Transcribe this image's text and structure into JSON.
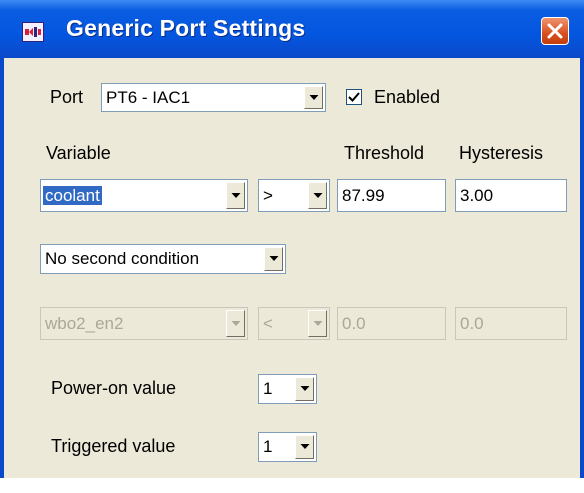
{
  "window": {
    "title": "Generic Port Settings"
  },
  "port": {
    "label": "Port",
    "value": "PT6 - IAC1"
  },
  "enabled": {
    "label": "Enabled",
    "checked": true
  },
  "headers": {
    "variable": "Variable",
    "threshold": "Threshold",
    "hysteresis": "Hysteresis"
  },
  "condition1": {
    "variable": "coolant",
    "operator": ">",
    "threshold": "87.99",
    "hysteresis": "3.00"
  },
  "second_condition": {
    "value": "No second condition"
  },
  "condition2": {
    "variable": "wbo2_en2",
    "operator": "<",
    "threshold": "0.0",
    "hysteresis": "0.0"
  },
  "power_on": {
    "label": "Power-on value",
    "value": "1"
  },
  "triggered": {
    "label": "Triggered value",
    "value": "1"
  },
  "icons": {
    "app": "port-settings-icon",
    "close": "close-icon",
    "dropdown": "chevron-down-icon",
    "check": "checkmark-icon"
  }
}
